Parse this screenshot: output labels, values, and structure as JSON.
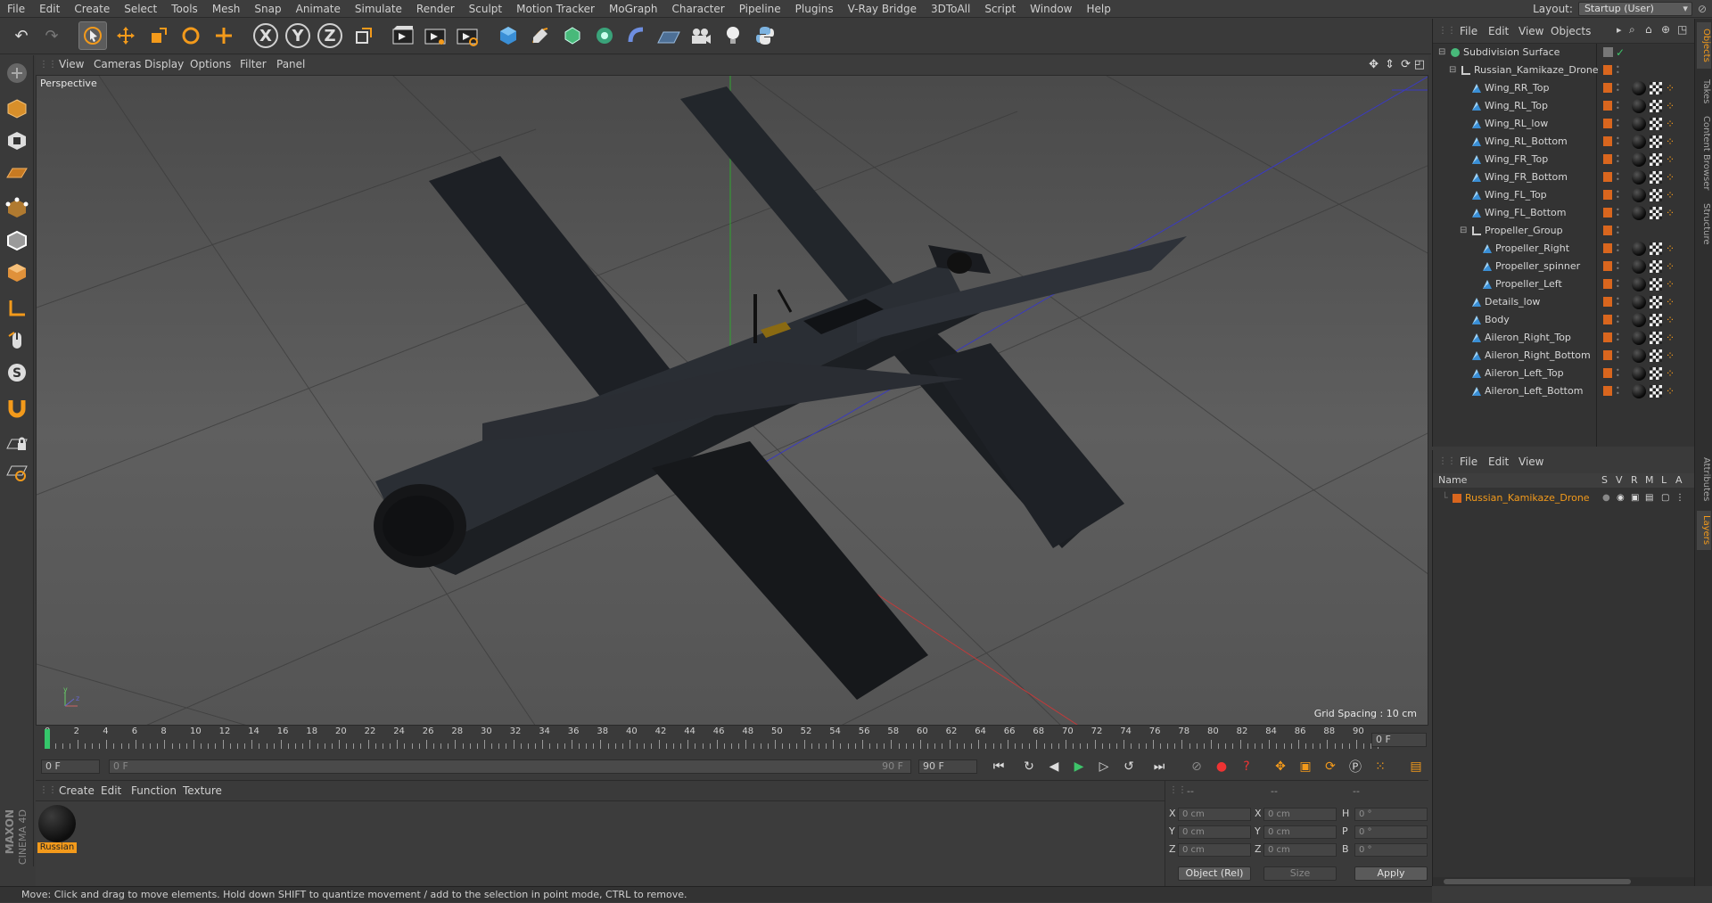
{
  "menu": [
    "File",
    "Edit",
    "Create",
    "Select",
    "Tools",
    "Mesh",
    "Snap",
    "Animate",
    "Simulate",
    "Render",
    "Sculpt",
    "Motion Tracker",
    "MoGraph",
    "Character",
    "Pipeline",
    "Plugins",
    "V-Ray Bridge",
    "3DToAll",
    "Script",
    "Window",
    "Help"
  ],
  "layout": {
    "label": "Layout:",
    "value": "Startup (User)"
  },
  "toolbar": {
    "x": "X",
    "y": "Y",
    "z": "Z"
  },
  "viewport": {
    "menu": [
      "View",
      "Cameras",
      "Display",
      "Options",
      "Filter",
      "Panel"
    ],
    "label": "Perspective",
    "grid_spacing": "Grid Spacing : 10 cm"
  },
  "timeline": {
    "ticks": [
      "0",
      "2",
      "4",
      "6",
      "8",
      "10",
      "12",
      "14",
      "16",
      "18",
      "20",
      "22",
      "24",
      "26",
      "28",
      "30",
      "32",
      "34",
      "36",
      "38",
      "40",
      "42",
      "44",
      "46",
      "48",
      "50",
      "52",
      "54",
      "56",
      "58",
      "60",
      "62",
      "64",
      "66",
      "68",
      "70",
      "72",
      "74",
      "76",
      "78",
      "80",
      "82",
      "84",
      "86",
      "88",
      "90"
    ],
    "current_frame": "0 F",
    "start": "0 F",
    "range_start": "0 F",
    "range_end": "90 F",
    "end": "90 F"
  },
  "materials": {
    "menu": [
      "Create",
      "Edit",
      "Function",
      "Texture"
    ],
    "items": [
      {
        "name": "Russian"
      }
    ]
  },
  "coords": {
    "headers": [
      "--",
      "--",
      "--"
    ],
    "rows": [
      {
        "l1": "X",
        "v1": "0 cm",
        "l2": "X",
        "v2": "0 cm",
        "l3": "H",
        "v3": "0 °"
      },
      {
        "l1": "Y",
        "v1": "0 cm",
        "l2": "Y",
        "v2": "0 cm",
        "l3": "P",
        "v3": "0 °"
      },
      {
        "l1": "Z",
        "v1": "0 cm",
        "l2": "Z",
        "v2": "0 cm",
        "l3": "B",
        "v3": "0 °"
      }
    ],
    "mode": "Object (Rel)",
    "size": "Size",
    "apply": "Apply"
  },
  "status": "Move: Click and drag to move elements. Hold down SHIFT to quantize movement / add to the selection in point mode, CTRL to remove.",
  "object_manager": {
    "menu": [
      "File",
      "Edit",
      "View",
      "Objects"
    ],
    "objects": [
      {
        "name": "Subdivision Surface"
      },
      {
        "name": "Russian_Kamikaze_Drone"
      },
      {
        "name": "Wing_RR_Top"
      },
      {
        "name": "Wing_RL_Top"
      },
      {
        "name": "Wing_RL_low"
      },
      {
        "name": "Wing_RL_Bottom"
      },
      {
        "name": "Wing_FR_Top"
      },
      {
        "name": "Wing_FR_Bottom"
      },
      {
        "name": "Wing_FL_Top"
      },
      {
        "name": "Wing_FL_Bottom"
      },
      {
        "name": "Propeller_Group"
      },
      {
        "name": "Propeller_Right"
      },
      {
        "name": "Propeller_spinner"
      },
      {
        "name": "Propeller_Left"
      },
      {
        "name": "Details_low"
      },
      {
        "name": "Body"
      },
      {
        "name": "Aileron_Right_Top"
      },
      {
        "name": "Aileron_Right_Bottom"
      },
      {
        "name": "Aileron_Left_Top"
      },
      {
        "name": "Aileron_Left_Bottom"
      }
    ]
  },
  "layer_manager": {
    "menu": [
      "File",
      "Edit",
      "View"
    ],
    "columns": [
      "Name",
      "S",
      "V",
      "R",
      "M",
      "L",
      "A"
    ],
    "layers": [
      {
        "name": "Russian_Kamikaze_Drone"
      }
    ]
  },
  "right_tabs": [
    "Objects",
    "Takes",
    "Content Browser",
    "Structure",
    "Attributes",
    "Layers"
  ],
  "brand": {
    "maxon": "MAXON",
    "product": "CINEMA 4D"
  }
}
